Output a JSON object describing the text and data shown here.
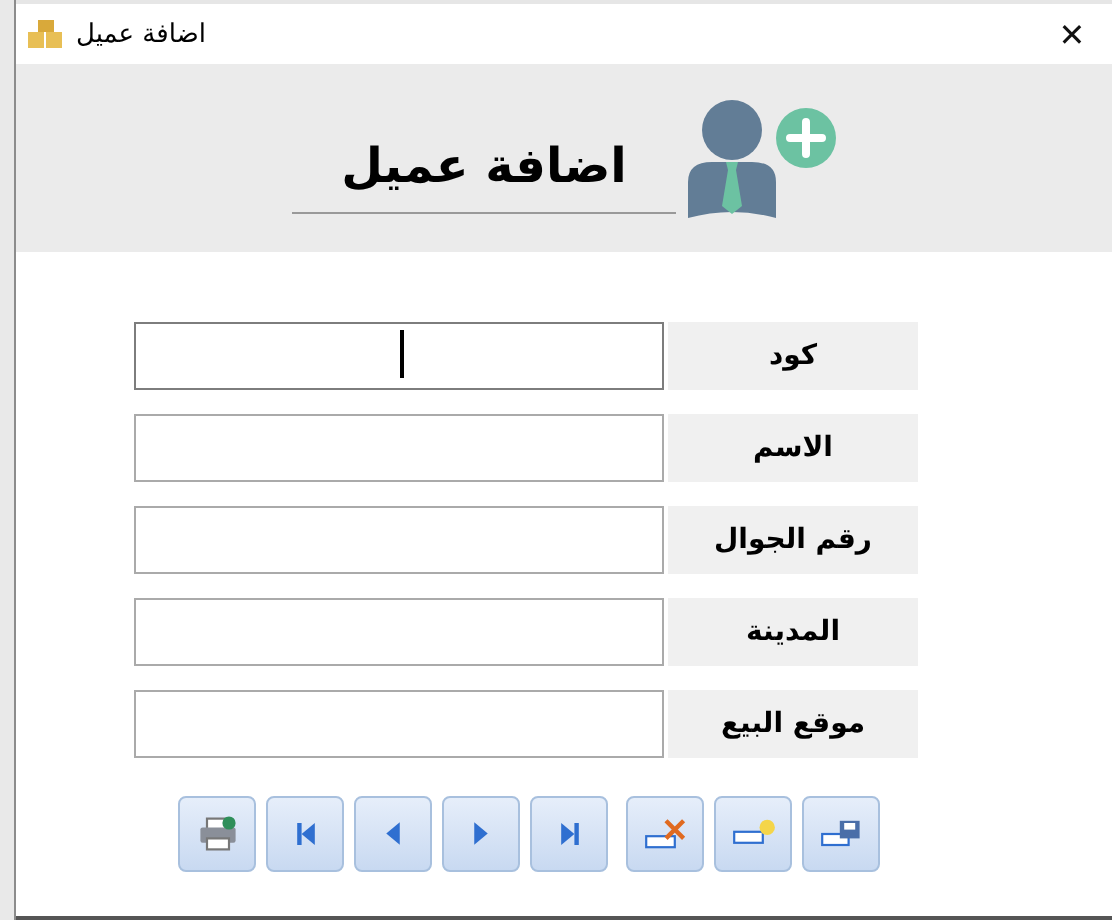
{
  "window": {
    "title": "اضافة عميل",
    "close": "✕"
  },
  "header": {
    "title": "اضافة عميل"
  },
  "fields": [
    {
      "label": "كود",
      "focused": true
    },
    {
      "label": "الاسم",
      "focused": false
    },
    {
      "label": "رقم الجوال",
      "focused": false
    },
    {
      "label": "المدينة",
      "focused": false
    },
    {
      "label": "موقع البيع",
      "focused": false
    }
  ],
  "buttons": [
    {
      "kind": "print"
    },
    {
      "kind": "first"
    },
    {
      "kind": "previous"
    },
    {
      "kind": "next"
    },
    {
      "kind": "last"
    },
    {
      "kind": "delete"
    },
    {
      "kind": "new"
    },
    {
      "kind": "save"
    }
  ]
}
